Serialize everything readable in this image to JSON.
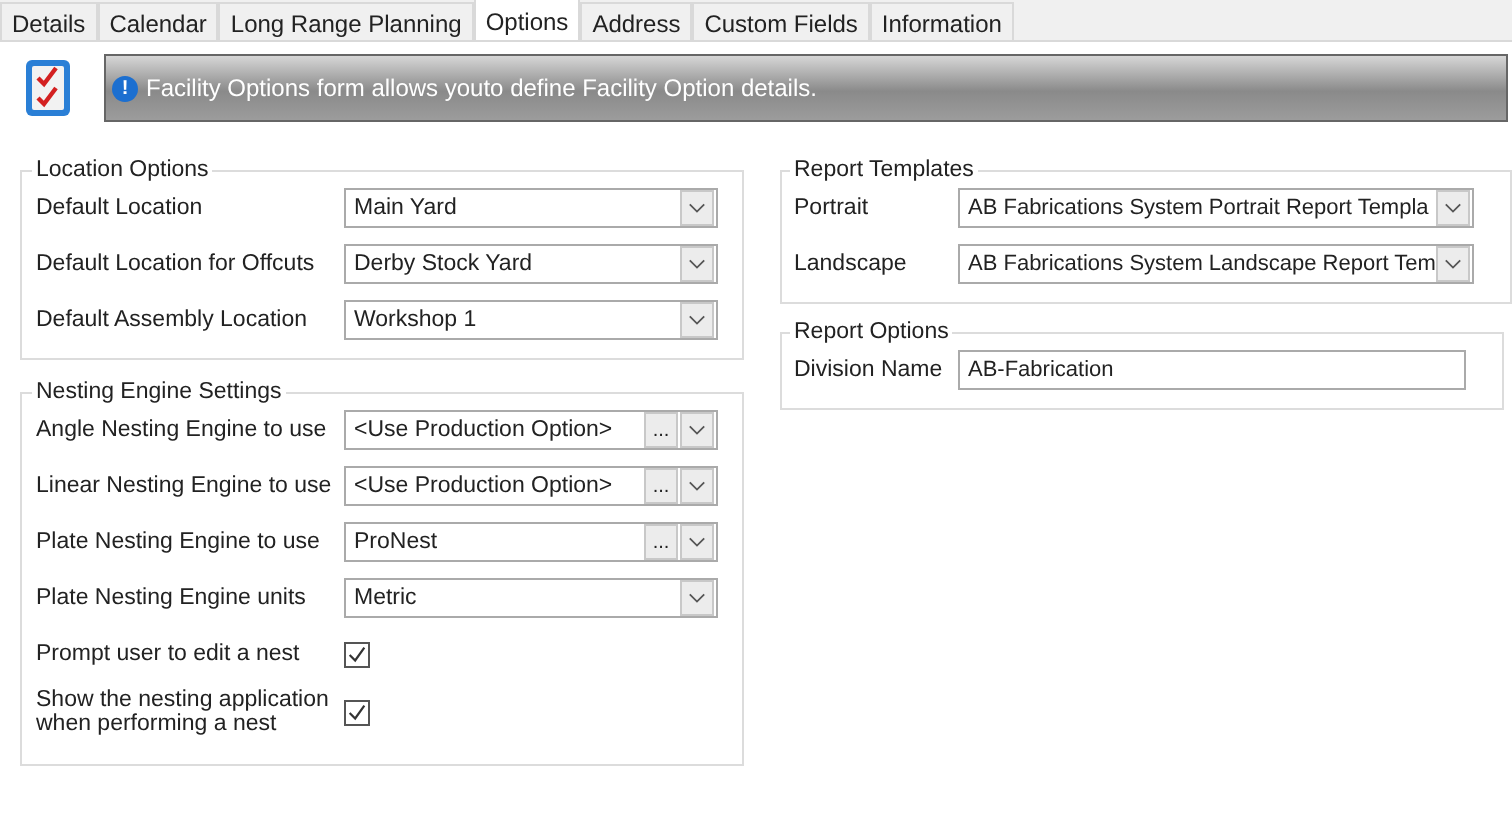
{
  "tabs": [
    {
      "label": "Details",
      "selected": false
    },
    {
      "label": "Calendar",
      "selected": false
    },
    {
      "label": "Long Range Planning",
      "selected": false
    },
    {
      "label": "Options",
      "selected": true
    },
    {
      "label": "Address",
      "selected": false
    },
    {
      "label": "Custom Fields",
      "selected": false
    },
    {
      "label": "Information",
      "selected": false
    }
  ],
  "banner": {
    "icon": "!",
    "text": "Facility Options form allows youto define Facility Option details."
  },
  "location_options": {
    "title": "Location Options",
    "rows": [
      {
        "kind": "dropdown",
        "label": "Default Location",
        "value": "Main Yard"
      },
      {
        "kind": "dropdown",
        "label": "Default Location for Offcuts",
        "value": "Derby Stock Yard"
      },
      {
        "kind": "dropdown",
        "label": "Default Assembly Location",
        "value": "Workshop 1"
      }
    ]
  },
  "nesting_engine_settings": {
    "title": "Nesting Engine Settings",
    "rows": [
      {
        "kind": "browse",
        "label": "Angle Nesting Engine to use",
        "value": "<Use Production Option>",
        "browse": "..."
      },
      {
        "kind": "browse",
        "label": "Linear Nesting Engine to use",
        "value": "<Use Production Option>",
        "browse": "..."
      },
      {
        "kind": "browse",
        "label": "Plate Nesting Engine to use",
        "value": "ProNest",
        "browse": "..."
      },
      {
        "kind": "dropdown",
        "label": "Plate Nesting Engine units",
        "value": "Metric"
      },
      {
        "kind": "checkbox",
        "label": "Prompt user to edit a nest",
        "checked": true
      },
      {
        "kind": "checkbox",
        "label": "Show the nesting application when performing a nest",
        "checked": true
      }
    ]
  },
  "report_templates": {
    "title": "Report Templates",
    "rows": [
      {
        "kind": "dropdown",
        "label": "Portrait",
        "value": "AB Fabrications System Portrait Report Templa"
      },
      {
        "kind": "dropdown",
        "label": "Landscape",
        "value": "AB Fabrications System Landscape Report Tem"
      }
    ]
  },
  "report_options": {
    "title": "Report Options",
    "rows": [
      {
        "kind": "text",
        "label": "Division Name",
        "value": "AB-Fabrication"
      }
    ]
  }
}
